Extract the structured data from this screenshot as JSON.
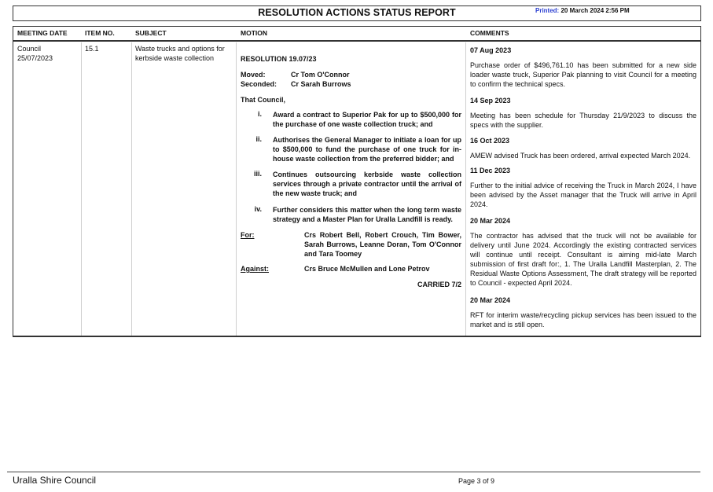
{
  "report": {
    "title": "RESOLUTION ACTIONS STATUS REPORT",
    "printed_label": "Printed:",
    "printed_value": "20 March 2024 2:56 PM"
  },
  "columns": {
    "meeting_date": "MEETING DATE",
    "item_no": "ITEM NO.",
    "subject": "SUBJECT",
    "motion": "MOTION",
    "comments": "COMMENTS"
  },
  "row": {
    "meeting_line1": "Council",
    "meeting_line2": "25/07/2023",
    "item_no": "15.1",
    "subject_line1": "Waste trucks and options for",
    "subject_line2": "kerbside waste collection",
    "motion": {
      "resolution": "RESOLUTION 19.07/23",
      "moved_label": "Moved:",
      "moved_value": "Cr Tom O'Connor",
      "seconded_label": "Seconded:",
      "seconded_value": "Cr Sarah Burrows",
      "that_council": "That Council,",
      "items": [
        {
          "num": "i.",
          "text": "Award a contract to Superior Pak for up to $500,000 for the purchase of one waste collection truck; and"
        },
        {
          "num": "ii.",
          "text": "Authorises the General Manager to initiate a loan for up to $500,000 to fund the purchase of one truck for in-house waste collection from the preferred bidder; and"
        },
        {
          "num": "iii.",
          "text": "Continues outsourcing kerbside waste collection services through a private contractor until the arrival of the new waste truck; and"
        },
        {
          "num": "iv.",
          "text": "Further considers this matter when the long term waste strategy and a Master Plan for Uralla Landfill is ready."
        }
      ],
      "for_label": "For:",
      "for_value": "Crs Robert Bell, Robert Crouch, Tim Bower, Sarah Burrows, Leanne Doran, Tom O'Connor and Tara Toomey",
      "against_label": "Against:",
      "against_value": "Crs Bruce McMullen and Lone Petrov",
      "carried": "CARRIED 7/2"
    },
    "comments": [
      {
        "date": "07 Aug 2023",
        "text": "Purchase order of $496,761.10 has been submitted for a new side loader waste truck, Superior Pak planning to visit Council for a meeting to confirm the technical specs."
      },
      {
        "date": "14 Sep 2023",
        "text": "Meeting has been schedule for Thursday 21/9/2023 to discuss the specs with the supplier."
      },
      {
        "date": "16 Oct 2023",
        "text": "AMEW advised Truck has been ordered, arrival expected March 2024."
      },
      {
        "date": "11 Dec 2023",
        "text": "Further to the initial advice of receiving the Truck in March 2024, I have been advised by the Asset manager that the Truck will arrive in April 2024."
      },
      {
        "date": "20 Mar 2024",
        "text": "The contractor has advised that the truck will not be available for delivery until June 2024. Accordingly the existing contracted services will continue until receipt. Consultant is aiming mid-late March submission of first draft for:, 1. The Uralla Landfill Masterplan, 2. The Residual Waste Options Assessment, The draft strategy will be reported to Council - expected April 2024."
      },
      {
        "date": "20 Mar 2024",
        "text": "RFT for interim waste/recycling pickup services has been issued to the market and is still open."
      }
    ]
  },
  "footer": {
    "org": "Uralla Shire Council",
    "page": "Page 3 of 9"
  }
}
